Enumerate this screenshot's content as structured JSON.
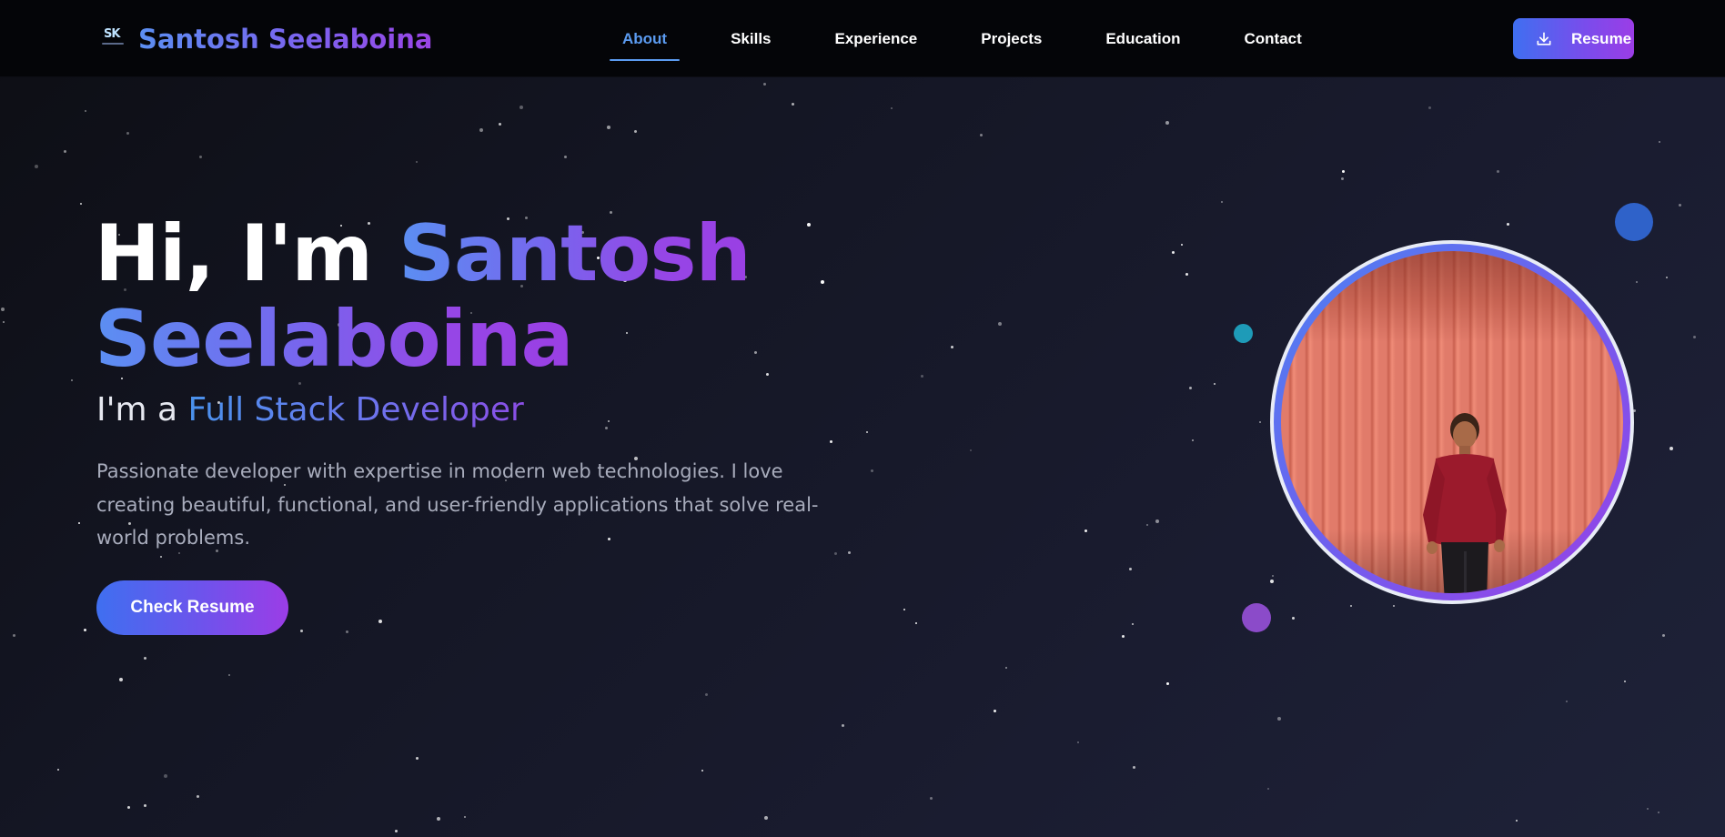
{
  "brand": {
    "logo_text": "SK",
    "name": "Santosh Seelaboina"
  },
  "nav": {
    "items": [
      {
        "label": "About",
        "active": true
      },
      {
        "label": "Skills",
        "active": false
      },
      {
        "label": "Experience",
        "active": false
      },
      {
        "label": "Projects",
        "active": false
      },
      {
        "label": "Education",
        "active": false
      },
      {
        "label": "Contact",
        "active": false
      }
    ],
    "resume_label": "Resume"
  },
  "hero": {
    "greeting": "Hi, I'm ",
    "first_name": "Santosh",
    "last_name": "Seelaboina",
    "sub_prefix": "I'm a ",
    "role": "Full Stack Developer",
    "description": "Passionate developer with expertise in modern web technologies. I love creating beautiful, functional, and user-friendly applications that solve real-world problems.",
    "cta_label": "Check Resume"
  },
  "colors": {
    "accent_blue": "#5b9bf0",
    "accent_purple": "#9a45e6",
    "navbar_bg": "#040508",
    "page_bg": "#141624"
  },
  "icons": {
    "resume_button": "download-icon",
    "logo": "sk-logo-icon"
  }
}
